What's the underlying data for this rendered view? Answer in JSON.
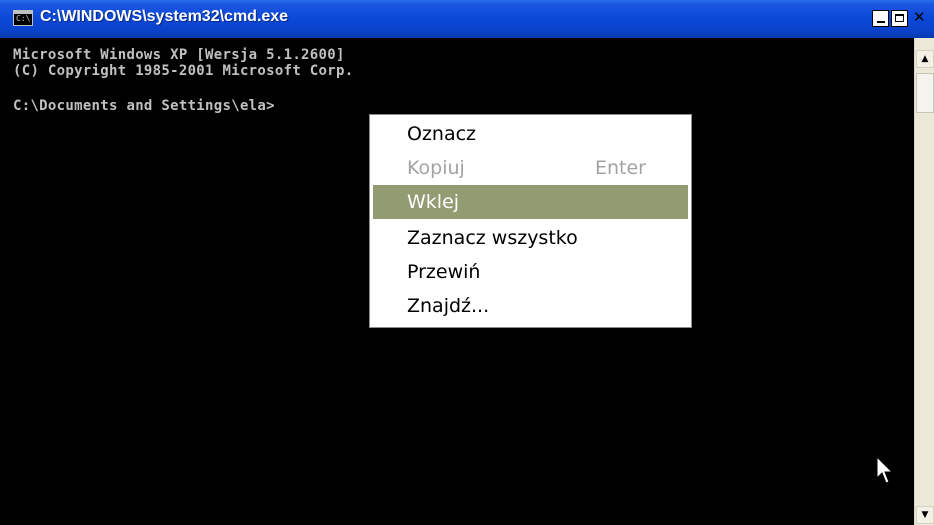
{
  "window": {
    "title": "C:\\WINDOWS\\system32\\cmd.exe",
    "icon_label": "C:\\"
  },
  "console": {
    "lines": [
      "Microsoft Windows XP [Wersja 5.1.2600]",
      "(C) Copyright 1985-2001 Microsoft Corp.",
      "C:\\Documents and Settings\\ela>"
    ]
  },
  "context_menu": {
    "items": [
      {
        "label": "Oznacz",
        "shortcut": "",
        "state": "enabled"
      },
      {
        "label": "Kopiuj",
        "shortcut": "Enter",
        "state": "disabled"
      },
      {
        "label": "Wklej",
        "shortcut": "",
        "state": "selected"
      },
      {
        "label": "Zaznacz wszystko",
        "shortcut": "",
        "state": "enabled"
      },
      {
        "label": "Przewiń",
        "shortcut": "",
        "state": "enabled"
      },
      {
        "label": "Znajdź...",
        "shortcut": "",
        "state": "enabled"
      }
    ]
  },
  "colors": {
    "titlebar": "#0b48d8",
    "console_bg": "#000000",
    "console_text": "#c0c0c0",
    "menu_highlight": "#939b73"
  },
  "icons": {
    "window_icon": "cmd-console-icon",
    "minimize": "minimize-icon",
    "maximize": "maximize-icon",
    "close": "close-icon",
    "scroll_up": "arrow-up-icon",
    "scroll_down": "arrow-down-icon",
    "cursor": "mouse-pointer-icon"
  }
}
